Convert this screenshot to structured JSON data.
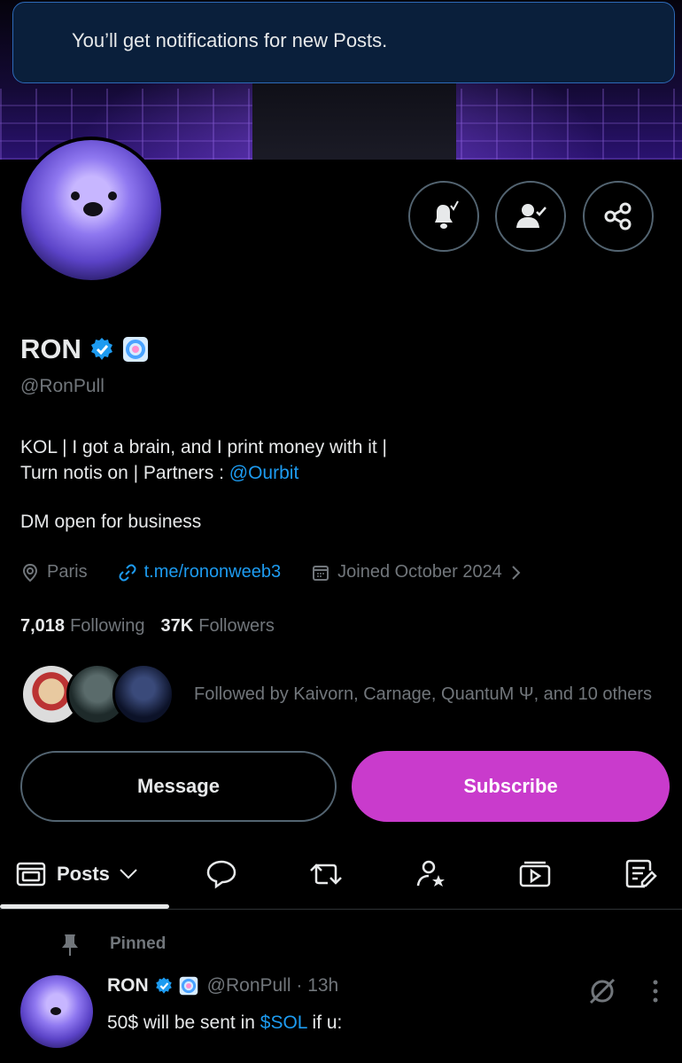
{
  "toast": {
    "message": "You’ll get notifications for new Posts."
  },
  "profile": {
    "name": "RON",
    "handle": "@RonPull",
    "bio_line1": "KOL | I got a brain, and I print money with it |",
    "bio_line2_prefix": "Turn notis on | Partners : ",
    "bio_partner": "@Ourbit",
    "bio_line3": "DM open for business",
    "location": "Paris",
    "website": "t.me/rononweeb3",
    "joined": "Joined October 2024",
    "following_count": "7,018",
    "following_label": "Following",
    "followers_count": "37K",
    "followers_label": "Followers",
    "followed_by": "Followed by Kaivorn, Carnage, QuantuM Ψ, and 10 others"
  },
  "actions": {
    "message": "Message",
    "subscribe": "Subscribe"
  },
  "tabs": {
    "posts_label": "Posts",
    "icons": [
      "speech-bubble-icon",
      "retweet-icon",
      "person-star-icon",
      "media-play-icon",
      "article-edit-icon"
    ]
  },
  "post": {
    "pinned_label": "Pinned",
    "name": "RON",
    "handle_time": "@RonPull · 13h",
    "text_prefix": "50$ will be sent in ",
    "text_cashtag": "$SOL",
    "text_suffix": " if u:"
  },
  "colors": {
    "accent_link": "#1d9bf0",
    "subscribe_bg": "#c93bcc",
    "toast_bg": "#0a1f3b",
    "muted": "#71767b"
  }
}
